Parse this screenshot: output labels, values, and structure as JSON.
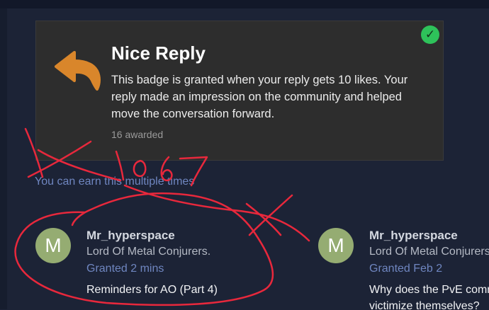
{
  "badge": {
    "title": "Nice Reply",
    "description": "This badge is granted when your reply gets 10 likes. Your reply made an impression on the community and helped move the conversation forward.",
    "awarded_count": "16 awarded",
    "icon": "reply-arrow-icon",
    "status_icon": "check-icon",
    "accent_color": "#d9862b",
    "status_color": "#2ec25a"
  },
  "multiple_note": "You can earn this multiple times",
  "grants": [
    {
      "avatar_letter": "M",
      "username": "Mr_hyperspace",
      "user_title": "Lord Of Metal Conjurers.",
      "granted": "Granted 2 mins",
      "topic": "Reminders for AO (Part 4)"
    },
    {
      "avatar_letter": "M",
      "username": "Mr_hyperspace",
      "user_title": "Lord Of Metal Conjurers",
      "granted": "Granted Feb 2",
      "topic": "Why does the PvE comm",
      "topic_line2": "victimize themselves?"
    }
  ],
  "annotation": {
    "handwritten_number": "1067",
    "ink_color": "#e8283c"
  }
}
